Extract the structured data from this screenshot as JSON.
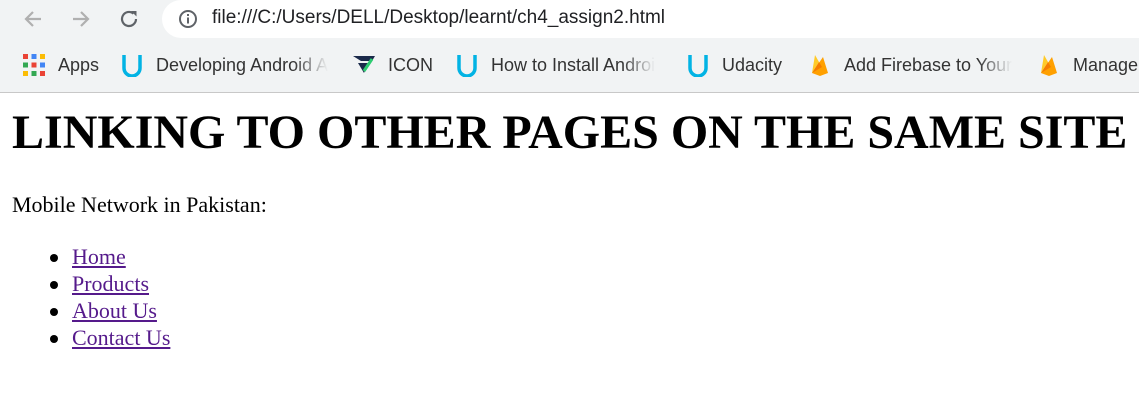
{
  "browser": {
    "url": "file:///C:/Users/DELL/Desktop/learnt/ch4_assign2.html",
    "bookmarks": [
      {
        "label": "Apps",
        "icon": "apps-grid-icon"
      },
      {
        "label": "Developing Android A",
        "icon": "udacity-icon"
      },
      {
        "label": "ICON",
        "icon": "icon-logo-icon"
      },
      {
        "label": "How to Install Androi",
        "icon": "udacity-icon"
      },
      {
        "label": "Udacity",
        "icon": "udacity-icon"
      },
      {
        "label": "Add Firebase to Your",
        "icon": "firebase-icon"
      },
      {
        "label": "Manage",
        "icon": "firebase-icon"
      }
    ]
  },
  "page": {
    "heading": "LINKING TO OTHER PAGES ON THE SAME SITE",
    "intro": "Mobile Network in Pakistan:",
    "links": [
      "Home",
      "Products",
      "About Us",
      "Contact Us"
    ],
    "colors": {
      "visited_link": "#551a8b",
      "toolbar": "#f1f3f4",
      "udacity": "#02b3e4",
      "firebase": "#ffa000"
    }
  }
}
